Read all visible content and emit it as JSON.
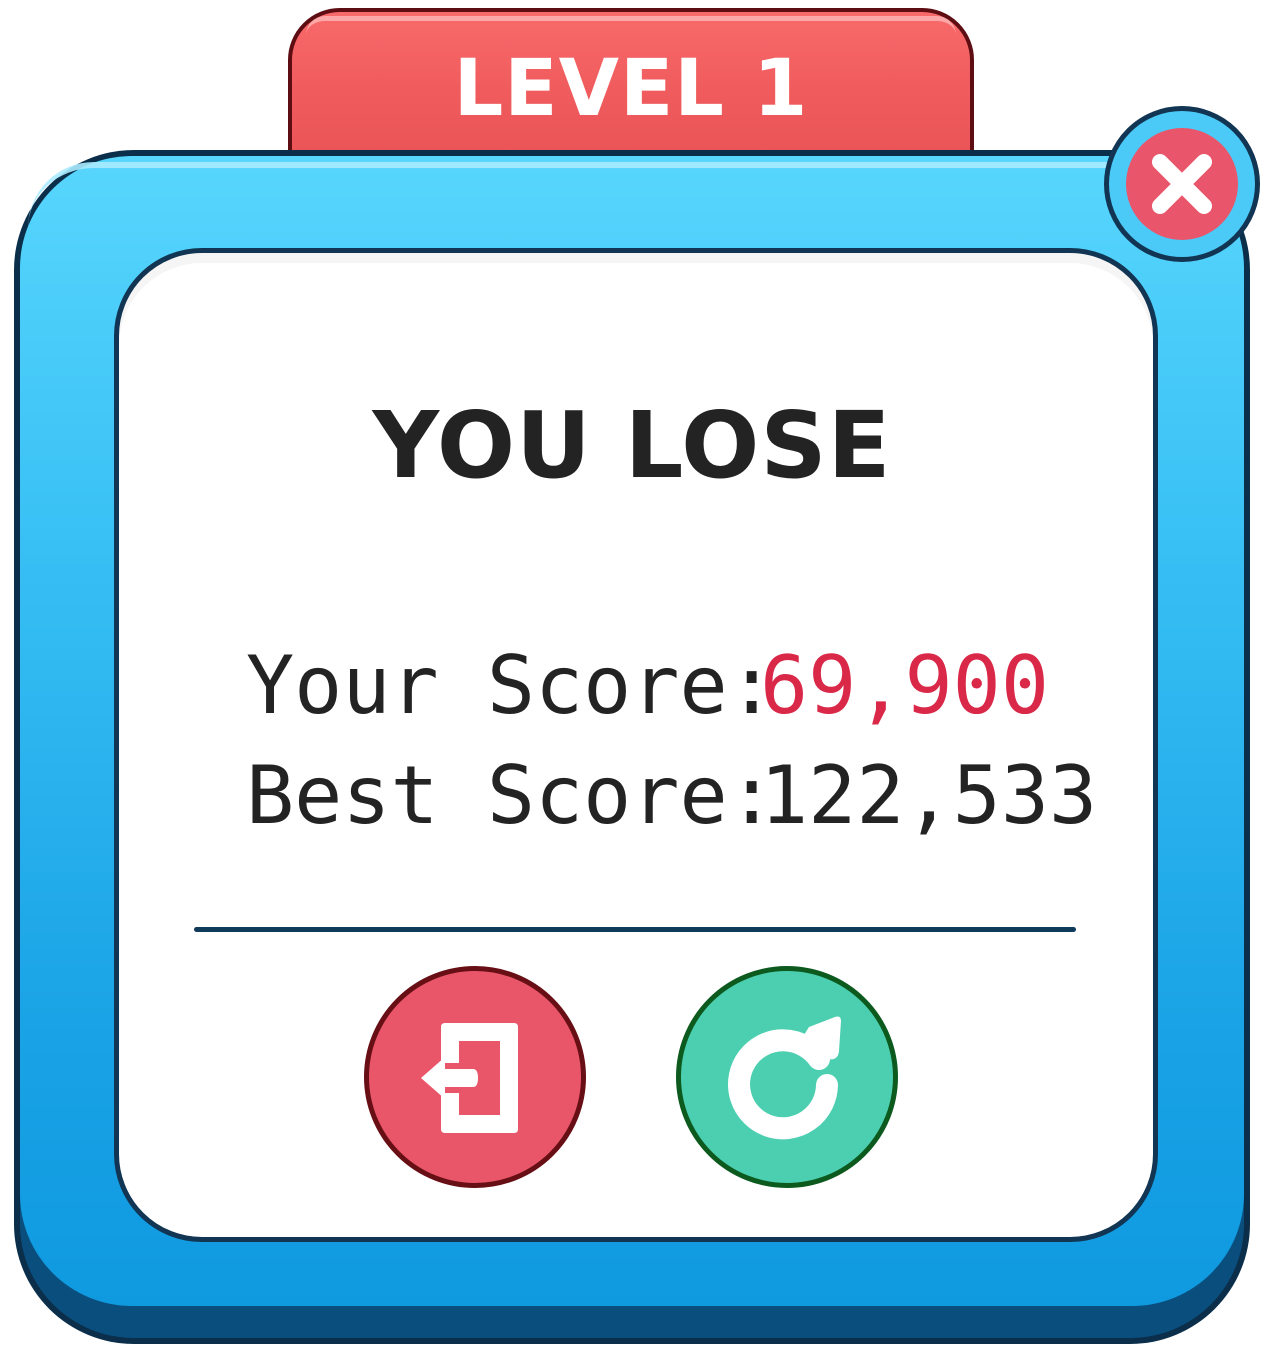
{
  "header": {
    "level_title": "LEVEL 1"
  },
  "result": {
    "title": "YOU LOSE"
  },
  "scores": {
    "your_label": "Your Score:",
    "your_value": "69,900",
    "best_label": "Best Score:",
    "best_value": "122,533"
  },
  "buttons": {
    "close_icon": "close-icon",
    "exit_icon": "exit-door-icon",
    "restart_icon": "restart-icon"
  },
  "colors": {
    "frame_blue": "#37bff4",
    "tab_red": "#ef5a5c",
    "score_highlight": "#d92848",
    "exit_button": "#e95569",
    "restart_button": "#4ccfb0",
    "outline_dark": "#113552"
  }
}
